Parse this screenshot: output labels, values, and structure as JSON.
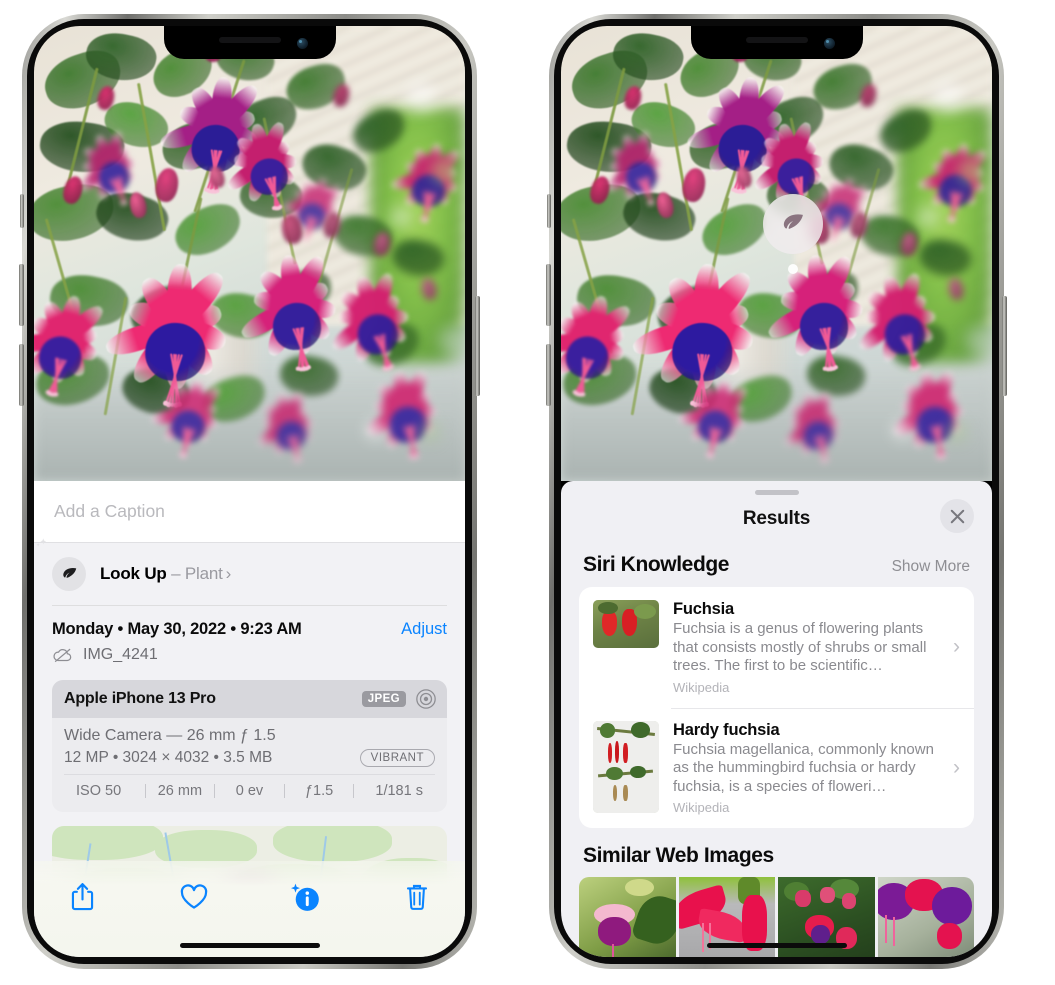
{
  "left_phone": {
    "caption_field": {
      "placeholder": "Add a Caption",
      "value": ""
    },
    "lookup_row": {
      "icon": "leaf-icon",
      "sparkle_icon": "sparkles-icon",
      "label": "Look Up",
      "dash": "–",
      "subject": "Plant",
      "chevron": "›"
    },
    "date_row": {
      "date_text": "Monday • May 30, 2022 • 9:23 AM",
      "adjust_label": "Adjust"
    },
    "file_row": {
      "icon": "icloud-slash-icon",
      "filename": "IMG_4241"
    },
    "metadata_card": {
      "device": "Apple iPhone 13 Pro",
      "format_badge": "JPEG",
      "raw_icon": "aperture-icon",
      "lens": "Wide Camera — 26 mm ƒ 1.5",
      "specs": "12 MP • 3024 × 4032 • 3.5 MB",
      "style_badge": "VIBRANT",
      "exif": [
        "ISO 50",
        "26 mm",
        "0 ev",
        "ƒ1.5",
        "1/181 s"
      ]
    },
    "map": {
      "pin": "photo-pin"
    },
    "toolbar": [
      {
        "name": "share-button",
        "icon": "share-icon"
      },
      {
        "name": "favorite-button",
        "icon": "heart-icon"
      },
      {
        "name": "info-button",
        "icon": "info-sparkle-icon"
      },
      {
        "name": "delete-button",
        "icon": "trash-icon"
      }
    ],
    "accent_color": "#0a84ff"
  },
  "right_phone": {
    "photo_badge": {
      "icon": "leaf-icon",
      "label": "visual-lookup-badge"
    },
    "sheet": {
      "grabber": "drag-handle",
      "title": "Results",
      "close_icon": "close-icon"
    },
    "siri_knowledge": {
      "title": "Siri Knowledge",
      "show_more": "Show More",
      "items": [
        {
          "name": "Fuchsia",
          "description": "Fuchsia is a genus of flowering plants that consists mostly of shrubs or small trees. The first to be scientific…",
          "source": "Wikipedia",
          "thumb": "fuchsia-red-flowers-thumb"
        },
        {
          "name": "Hardy fuchsia",
          "description": "Fuchsia magellanica, commonly known as the hummingbird fuchsia or hardy fuchsia, is a species of floweri…",
          "source": "Wikipedia",
          "thumb": "hardy-fuchsia-branch-thumb"
        }
      ]
    },
    "similar_web_images": {
      "title": "Similar Web Images",
      "thumbs": [
        "fuchsia-pink-white-thumb",
        "fuchsia-red-closeup-thumb",
        "fuchsia-bush-thumb",
        "fuchsia-purple-cluster-thumb"
      ]
    }
  }
}
